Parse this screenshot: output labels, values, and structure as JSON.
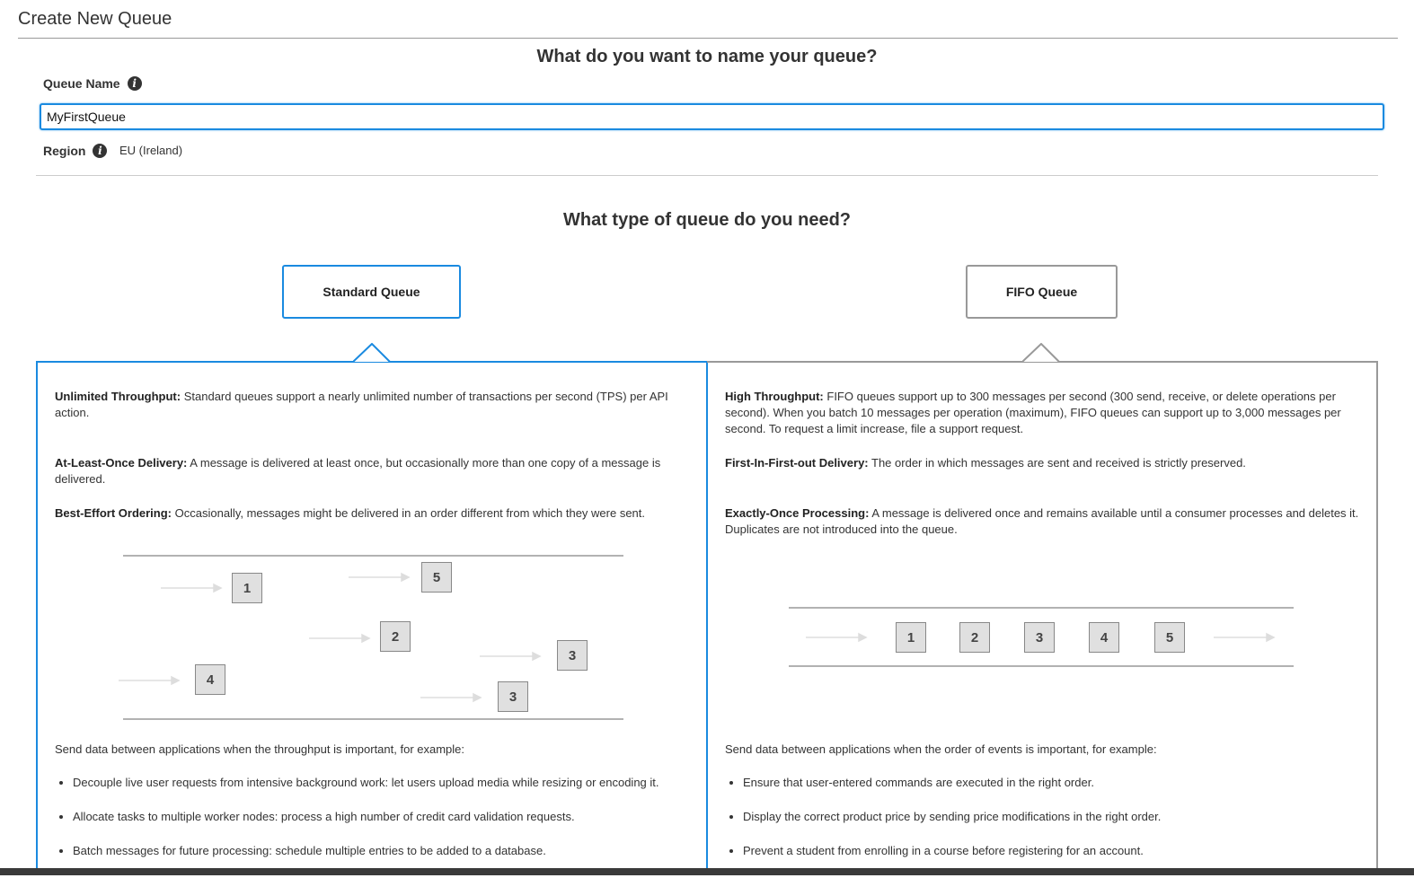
{
  "page_title": "Create New Queue",
  "name_section": {
    "heading": "What do you want to name your queue?",
    "queue_name_label": "Queue Name",
    "queue_name_value": "MyFirstQueue",
    "region_label": "Region",
    "region_value": "EU (Ireland)"
  },
  "type_section": {
    "heading": "What type of queue do you need?",
    "selected": "standard",
    "standard_label": "Standard Queue",
    "fifo_label": "FIFO Queue"
  },
  "standard": {
    "features": [
      {
        "title": "Unlimited Throughput:",
        "text": "Standard queues support a nearly unlimited number of transactions per second (TPS) per API action."
      },
      {
        "title": "At-Least-Once Delivery:",
        "text": "A message is delivered at least once, but occasionally more than one copy of a message is delivered."
      },
      {
        "title": "Best-Effort Ordering:",
        "text": "Occasionally, messages might be delivered in an order different from which they were sent."
      }
    ],
    "diagram_boxes": [
      "1",
      "5",
      "2",
      "3",
      "4",
      "3"
    ],
    "usecase_intro": "Send data between applications when the throughput is important, for example:",
    "usecases": [
      "Decouple live user requests from intensive background work: let users upload media while resizing or encoding it.",
      "Allocate tasks to multiple worker nodes: process a high number of credit card validation requests.",
      "Batch messages for future processing: schedule multiple entries to be added to a database."
    ]
  },
  "fifo": {
    "features": [
      {
        "title": "High Throughput:",
        "text": "FIFO queues support up to 300 messages per second (300 send, receive, or delete operations per second). When you batch 10 messages per operation (maximum), FIFO queues can support up to 3,000 messages per second. To request a limit increase, file a support request."
      },
      {
        "title": "First-In-First-out Delivery:",
        "text": "The order in which messages are sent and received is strictly preserved."
      },
      {
        "title": "Exactly-Once Processing:",
        "text": "A message is delivered once and remains available until a consumer processes and deletes it. Duplicates are not introduced into the queue."
      }
    ],
    "diagram_boxes": [
      "1",
      "2",
      "3",
      "4",
      "5"
    ],
    "usecase_intro": "Send data between applications when the order of events is important, for example:",
    "usecases": [
      "Ensure that user-entered commands are executed in the right order.",
      "Display the correct product price by sending price modifications in the right order.",
      "Prevent a student from enrolling in a course before registering for an account."
    ]
  },
  "colors": {
    "accent": "#1a8ae0",
    "border_gray": "#999999",
    "box_fill": "#e0e0e0"
  },
  "icons": {
    "info": "info-icon"
  }
}
